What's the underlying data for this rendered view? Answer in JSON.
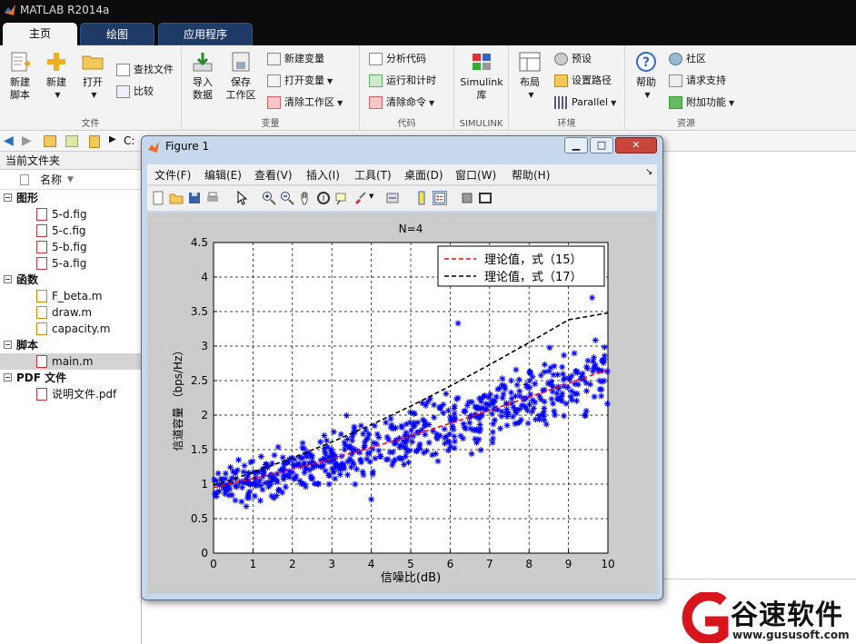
{
  "app": {
    "title": "MATLAB R2014a"
  },
  "tabs": [
    "主页",
    "绘图",
    "应用程序"
  ],
  "ribbon": {
    "file_group": {
      "name": "文件",
      "new_script": "新建\n脚本",
      "new": "新建",
      "open": "打开",
      "find_files": "查找文件",
      "compare": "比较"
    },
    "var_group": {
      "name": "变量",
      "import": "导入\n数据",
      "save_ws": "保存\n工作区",
      "new_var": "新建变量",
      "open_var": "打开变量",
      "clear_ws": "清除工作区"
    },
    "code_group": {
      "name": "代码",
      "analyze": "分析代码",
      "run_time": "运行和计时",
      "clear_cmd": "清除命令"
    },
    "simulink_group": {
      "name": "SIMULINK",
      "lib": "Simulink\n库"
    },
    "env_group": {
      "name": "环境",
      "layout": "布局",
      "prefs": "预设",
      "set_path": "设置路径",
      "parallel": "Parallel"
    },
    "res_group": {
      "name": "资源",
      "help": "帮助",
      "community": "社区",
      "support": "请求支持",
      "addons": "附加功能"
    }
  },
  "address": {
    "path": "C:"
  },
  "panel": {
    "title": "当前文件夹",
    "col_name": "名称",
    "sections": [
      {
        "label": "图形",
        "files": [
          "5-d.fig",
          "5-c.fig",
          "5-b.fig",
          "5-a.fig"
        ]
      },
      {
        "label": "函数",
        "files": [
          "F_beta.m",
          "draw.m",
          "capacity.m"
        ]
      },
      {
        "label": "脚本",
        "files": [
          "main.m"
        ]
      },
      {
        "label": "PDF 文件",
        "files": [
          "说明文件.pdf"
        ]
      }
    ]
  },
  "figure": {
    "title": "Figure 1",
    "menus": [
      "文件(F)",
      "编辑(E)",
      "查看(V)",
      "插入(I)",
      "工具(T)",
      "桌面(D)",
      "窗口(W)",
      "帮助(H)"
    ]
  },
  "chart_data": {
    "type": "scatter",
    "title": "N=4",
    "xlabel": "信噪比(dB)",
    "ylabel": "信道容量 （bps/Hz）",
    "xlim": [
      0,
      10
    ],
    "ylim": [
      0,
      4.5
    ],
    "xticks": [
      "0",
      "1",
      "2",
      "3",
      "4",
      "5",
      "6",
      "7",
      "8",
      "9",
      "10"
    ],
    "yticks": [
      "0",
      "0.5",
      "1",
      "1.5",
      "2",
      "2.5",
      "3",
      "3.5",
      "4",
      "4.5"
    ],
    "grid": true,
    "legend_position": "top-right",
    "series": [
      {
        "name": "理论值，式（15）",
        "style": "dashed",
        "color": "#ff0000",
        "x": [
          0,
          1,
          2,
          3,
          4,
          5,
          6,
          7,
          8,
          9,
          10
        ],
        "y": [
          0.95,
          1.08,
          1.22,
          1.37,
          1.53,
          1.7,
          1.88,
          2.07,
          2.26,
          2.46,
          2.66
        ]
      },
      {
        "name": "理论值，式（17）",
        "style": "dashed",
        "color": "#000000",
        "x": [
          0,
          1,
          2,
          3,
          4,
          5,
          6,
          7,
          8,
          9,
          10
        ],
        "y": [
          0.98,
          1.17,
          1.38,
          1.61,
          1.86,
          2.13,
          2.42,
          2.73,
          3.05,
          3.38,
          3.48
        ]
      }
    ],
    "scatter": {
      "marker": "*",
      "color": "#0000ff",
      "approx_mean_curve": "理论值，式（15）",
      "spread": 0.3,
      "outliers": [
        {
          "x": 6.2,
          "y": 3.33
        },
        {
          "x": 9.6,
          "y": 3.7
        },
        {
          "x": 4.0,
          "y": 0.78
        }
      ]
    }
  },
  "watermark": {
    "brand": "谷速软件",
    "url": "www.gususoft.com"
  }
}
